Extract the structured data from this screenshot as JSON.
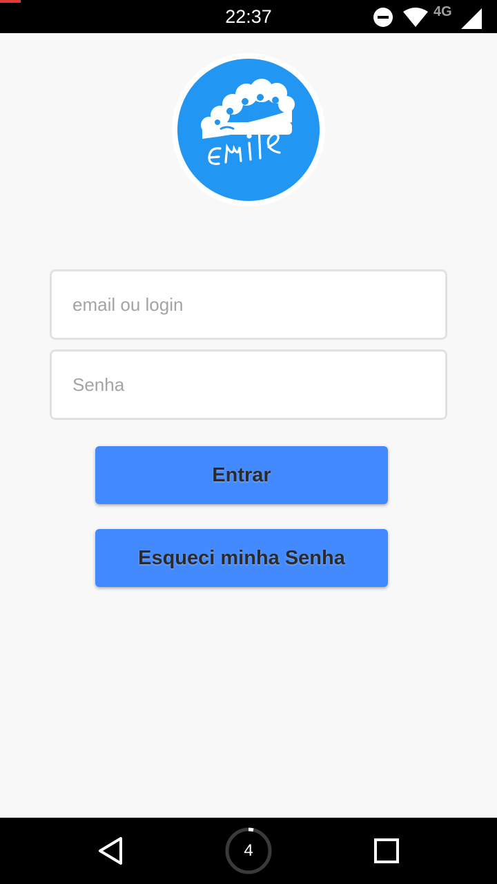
{
  "status_bar": {
    "time": "22:37",
    "network_label": "4G",
    "icons": [
      "do-not-disturb-icon",
      "wifi-icon",
      "cell-signal-icon"
    ]
  },
  "app": {
    "logo_text": "Emile",
    "brand_color": "#2196f3"
  },
  "login_form": {
    "email_placeholder": "email ou login",
    "password_placeholder": "Senha",
    "login_button": "Entrar",
    "forgot_button": "Esqueci minha Senha",
    "button_color": "#448aff"
  },
  "nav_bar": {
    "home_badge": "4",
    "icons": [
      "back-icon",
      "home-icon",
      "recents-icon"
    ]
  }
}
